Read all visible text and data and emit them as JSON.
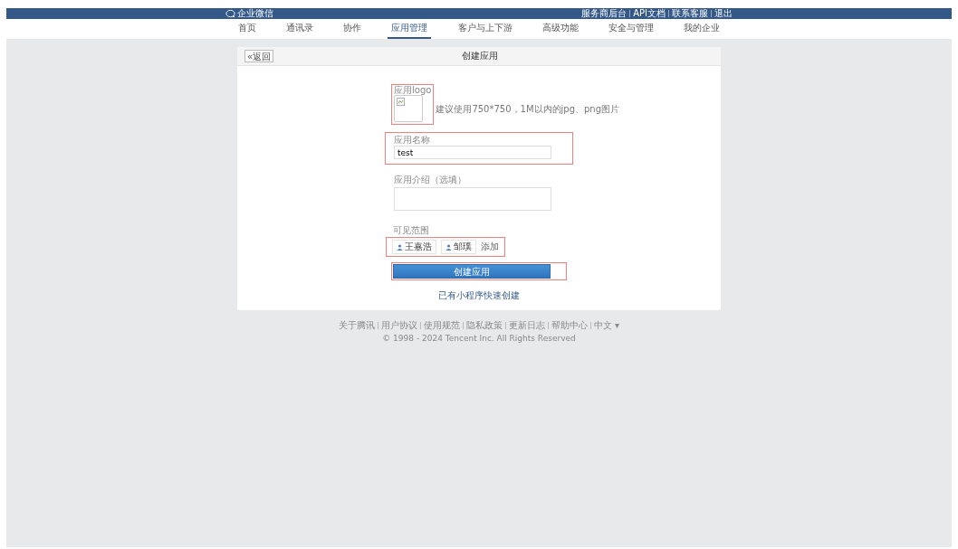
{
  "topbar": {
    "logo_text": "企业微信",
    "links": [
      "服务商后台",
      "API文档",
      "联系客服",
      "退出"
    ]
  },
  "nav": {
    "items": [
      {
        "label": "首页",
        "selected": false
      },
      {
        "label": "通讯录",
        "selected": false
      },
      {
        "label": "协作",
        "selected": false
      },
      {
        "label": "应用管理",
        "selected": true
      },
      {
        "label": "客户与上下游",
        "selected": false
      },
      {
        "label": "高级功能",
        "selected": false
      },
      {
        "label": "安全与管理",
        "selected": false
      },
      {
        "label": "我的企业",
        "selected": false
      }
    ]
  },
  "panel": {
    "back_button": "«返回",
    "title": "创建应用",
    "form": {
      "logo": {
        "label": "应用logo",
        "hint": "建议使用750*750，1M以内的jpg、png图片",
        "highlighted": true
      },
      "name": {
        "label": "应用名称",
        "value": "test",
        "highlighted": true
      },
      "intro": {
        "label": "应用介绍（选填）",
        "highlighted": false
      },
      "scope": {
        "label": "可见范围",
        "members": [
          "王嘉浩",
          "邹璞"
        ],
        "add": "添加",
        "highlighted": true
      },
      "submit": {
        "label": "创建应用",
        "highlighted": true
      },
      "link": "已有小程序快速创建"
    }
  },
  "footer": {
    "links": [
      "关于腾讯",
      "用户协议",
      "使用规范",
      "隐私政策",
      "更新日志",
      "帮助中心"
    ],
    "language": "中文 ▾",
    "copyright": "© 1998 - 2024 Tencent Inc. All Rights Reserved"
  }
}
